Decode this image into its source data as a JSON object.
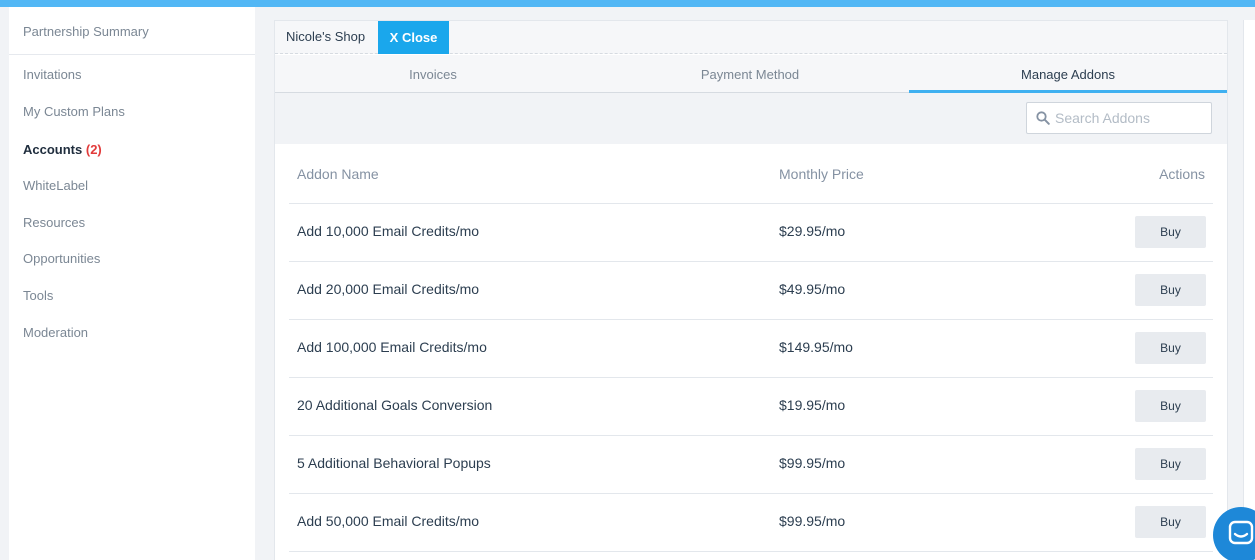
{
  "sidebar": {
    "items": [
      {
        "label": "Partnership Summary"
      },
      {
        "label": "Invitations"
      },
      {
        "label": "My Custom Plans"
      },
      {
        "label": "Accounts",
        "count": "(2)"
      },
      {
        "label": "WhiteLabel"
      },
      {
        "label": "Resources"
      },
      {
        "label": "Opportunities"
      },
      {
        "label": "Tools"
      },
      {
        "label": "Moderation"
      }
    ]
  },
  "panel": {
    "shop_name": "Nicole's Shop",
    "close_label": "X Close",
    "tabs": [
      {
        "label": "Invoices"
      },
      {
        "label": "Payment Method"
      },
      {
        "label": "Manage Addons"
      }
    ],
    "search": {
      "placeholder": "Search Addons",
      "value": ""
    },
    "table": {
      "headers": [
        "Addon Name",
        "Monthly Price",
        "Actions"
      ],
      "rows": [
        {
          "name": "Add 10,000 Email Credits/mo",
          "price": "$29.95/mo",
          "action": "Buy"
        },
        {
          "name": "Add 20,000 Email Credits/mo",
          "price": "$49.95/mo",
          "action": "Buy"
        },
        {
          "name": "Add 100,000 Email Credits/mo",
          "price": "$149.95/mo",
          "action": "Buy"
        },
        {
          "name": "20 Additional Goals Conversion",
          "price": "$19.95/mo",
          "action": "Buy"
        },
        {
          "name": "5 Additional Behavioral Popups",
          "price": "$99.95/mo",
          "action": "Buy"
        },
        {
          "name": "Add 50,000 Email Credits/mo",
          "price": "$99.95/mo",
          "action": "Buy"
        }
      ]
    }
  },
  "colors": {
    "accent": "#1aa7ec",
    "topbar": "#52b7f5",
    "alert": "#e23b3b"
  },
  "icons": {
    "search": "search-icon",
    "chat": "chat-icon"
  }
}
